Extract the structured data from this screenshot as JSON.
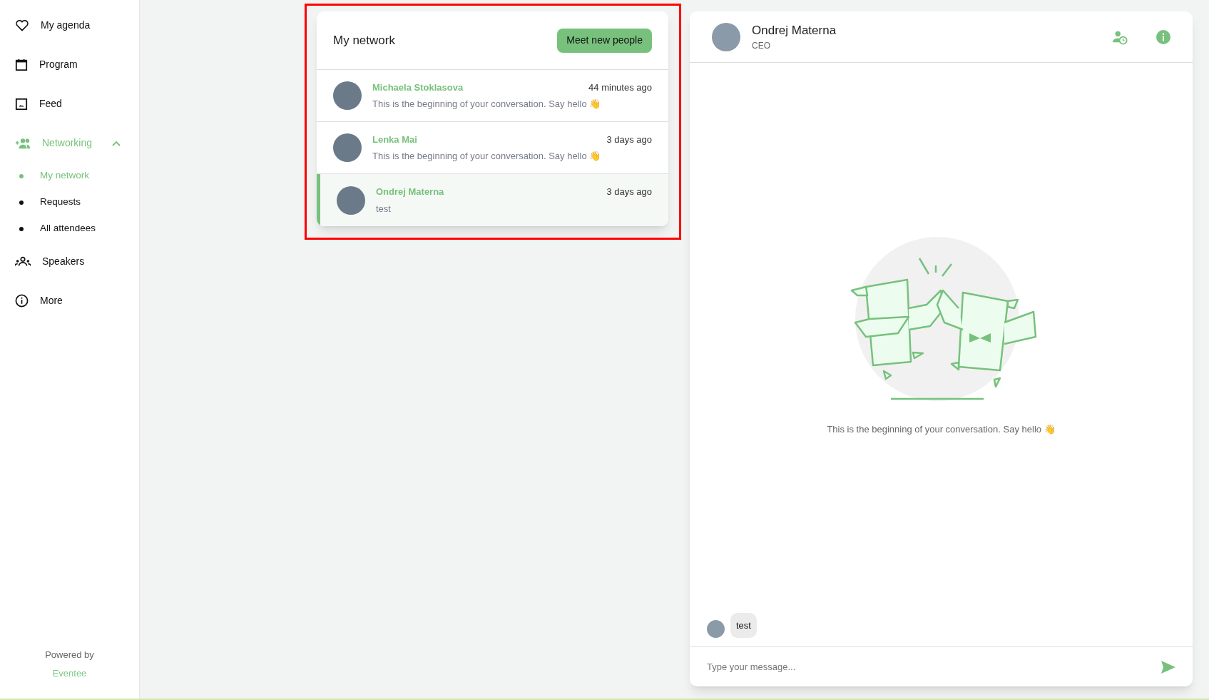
{
  "sidebar": {
    "items": [
      {
        "label": "My agenda",
        "selected": false
      },
      {
        "label": "Program",
        "selected": false
      },
      {
        "label": "Feed",
        "selected": false
      },
      {
        "label": "Networking",
        "selected": true,
        "expanded": true,
        "children": [
          {
            "label": "My network",
            "selected": true
          },
          {
            "label": "Requests",
            "selected": false
          },
          {
            "label": "All attendees",
            "selected": false
          }
        ]
      },
      {
        "label": "Speakers",
        "selected": false
      },
      {
        "label": "More",
        "selected": false
      }
    ],
    "footer": {
      "text": "Powered by",
      "link": "Eventee"
    }
  },
  "network": {
    "title": "My network",
    "button": "Meet new people",
    "conversations": [
      {
        "name": "Michaela Stoklasova",
        "time": "44 minutes ago",
        "preview": "This is the beginning of your conversation. Say hello 👋",
        "selected": false
      },
      {
        "name": "Lenka Mai",
        "time": "3 days ago",
        "preview": "This is the beginning of your conversation. Say hello 👋",
        "selected": false
      },
      {
        "name": "Ondrej Materna",
        "time": "3 days ago",
        "preview": "test",
        "selected": true
      }
    ]
  },
  "chat": {
    "name": "Ondrej Materna",
    "role": "CEO",
    "empty_text": "This is the beginning of your conversation. Say hello 👋",
    "messages": [
      {
        "text": "test"
      }
    ],
    "input": {
      "placeholder": "Type your message..."
    }
  }
}
